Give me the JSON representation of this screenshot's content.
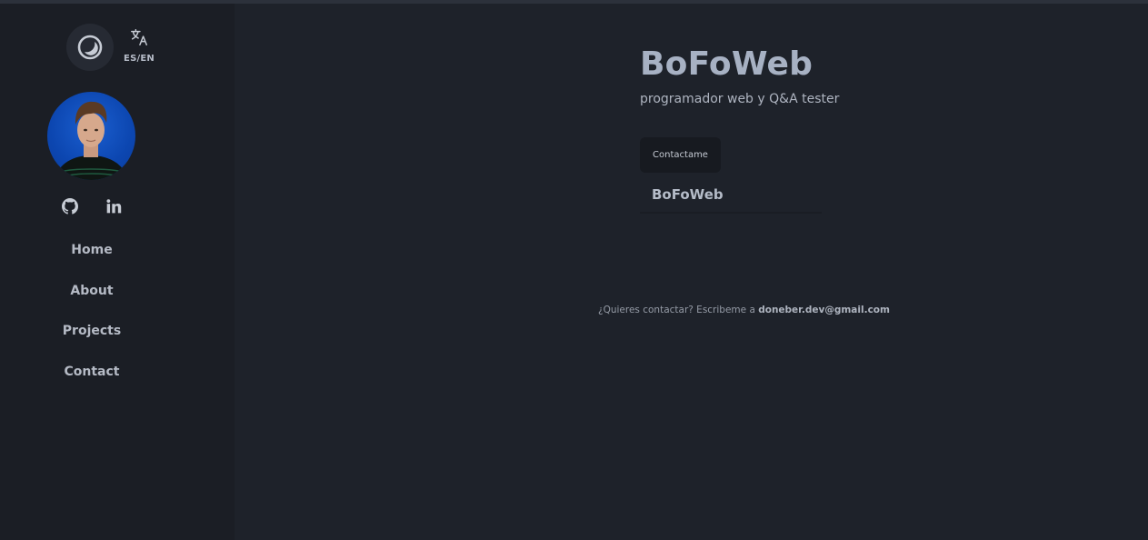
{
  "sidebar": {
    "lang_label": "ES/EN",
    "nav": [
      {
        "label": "Home"
      },
      {
        "label": "About"
      },
      {
        "label": "Projects"
      },
      {
        "label": "Contact"
      }
    ]
  },
  "hero": {
    "title": "BoFoWeb",
    "subtitle": "programador web y Q&A tester",
    "contact_button": "Contactame",
    "card_title": "BoFoWeb"
  },
  "footer": {
    "prefix": "¿Quieres contactar? Escribeme a ",
    "email": "doneber.dev@gmail.com"
  },
  "colors": {
    "background": "#1e222a",
    "sidebar": "#1b1e25",
    "avatar_bg": "#0c46b0"
  }
}
